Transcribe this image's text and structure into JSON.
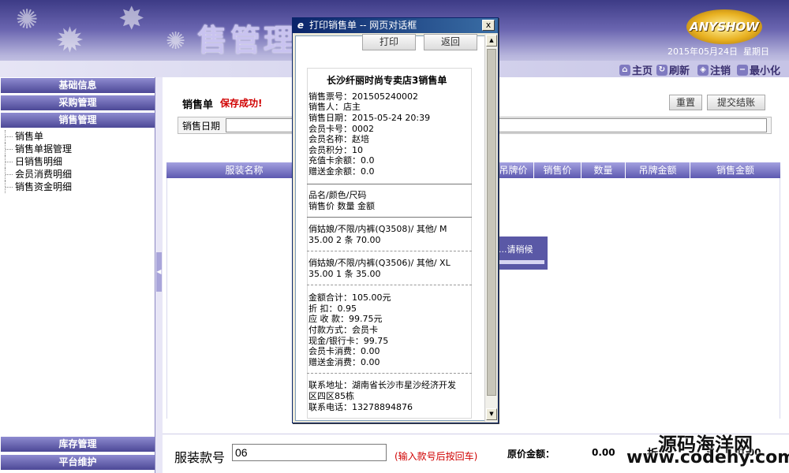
{
  "header": {
    "system_title": "售管理系统",
    "logo_text": "ANYSHOW",
    "date": "2015年05月24日",
    "weekday": "星期日",
    "toolbar": {
      "home": "主页",
      "refresh": "刷新",
      "logout": "注销",
      "minimize": "最小化"
    }
  },
  "sidebar": {
    "menus": {
      "basic": "基础信息",
      "purchase": "采购管理",
      "sales": "销售管理",
      "inventory": "库存管理",
      "platform": "平台维护"
    },
    "sales_items": [
      "销售单",
      "销售单据管理",
      "日销售明细",
      "会员消费明细",
      "销售资金明细"
    ]
  },
  "main": {
    "title": "销售单",
    "save_msg": "保存成功!",
    "reset_label": "重置",
    "submit_label": "提交结账",
    "date_label": "销售日期",
    "date_value": "",
    "table_headers": [
      "服装名称",
      "吊牌价",
      "销售价",
      "数量",
      "吊牌金额",
      "销售金额"
    ],
    "loading_text": "...请稍候",
    "code_label": "服装款号",
    "code_value": "06",
    "code_hint": "(输入款号后按回车)",
    "orig_label": "原价金额：",
    "orig_value": "0.00",
    "disc_label": "折",
    "disc_value": "0.00"
  },
  "watermark": {
    "line1": "源码海洋网",
    "line2": "www.codehy.com"
  },
  "dialog": {
    "title": "打印销售单 -- 网页对话框",
    "close": "x",
    "print_label": "打印",
    "back_label": "返回",
    "receipt": {
      "title": "长沙纤丽时尚专卖店3销售单",
      "info": [
        "销售票号：201505240002",
        "销售人：店主",
        "销售日期：2015-05-24 20:39",
        "会员卡号：0002",
        "会员名称：赵培",
        "会员积分：10",
        "充值卡余额：0.0",
        "赠送金余额：0.0"
      ],
      "col_header1": "品名/颜色/尺码",
      "col_header2": "销售价    数量    金额",
      "items": [
        {
          "name": "俏姑娘/不限/内裤(Q3508)/ 其他/ M",
          "detail": "35.00    2 条    70.00"
        },
        {
          "name": "俏姑娘/不限/内裤(Q3506)/ 其他/ XL",
          "detail": "35.00    1 条    35.00"
        }
      ],
      "totals": [
        "金额合计：105.00元",
        "折    扣：0.95",
        "应 收 款：99.75元",
        "付款方式：会员卡",
        "现金/银行卡：99.75",
        "会员卡消费：0.00",
        "赠送金消费：0.00"
      ],
      "contact": [
        "联系地址：湖南省长沙市星沙经济开发",
        "区四区85栋",
        "联系电话：13278894876"
      ]
    }
  }
}
